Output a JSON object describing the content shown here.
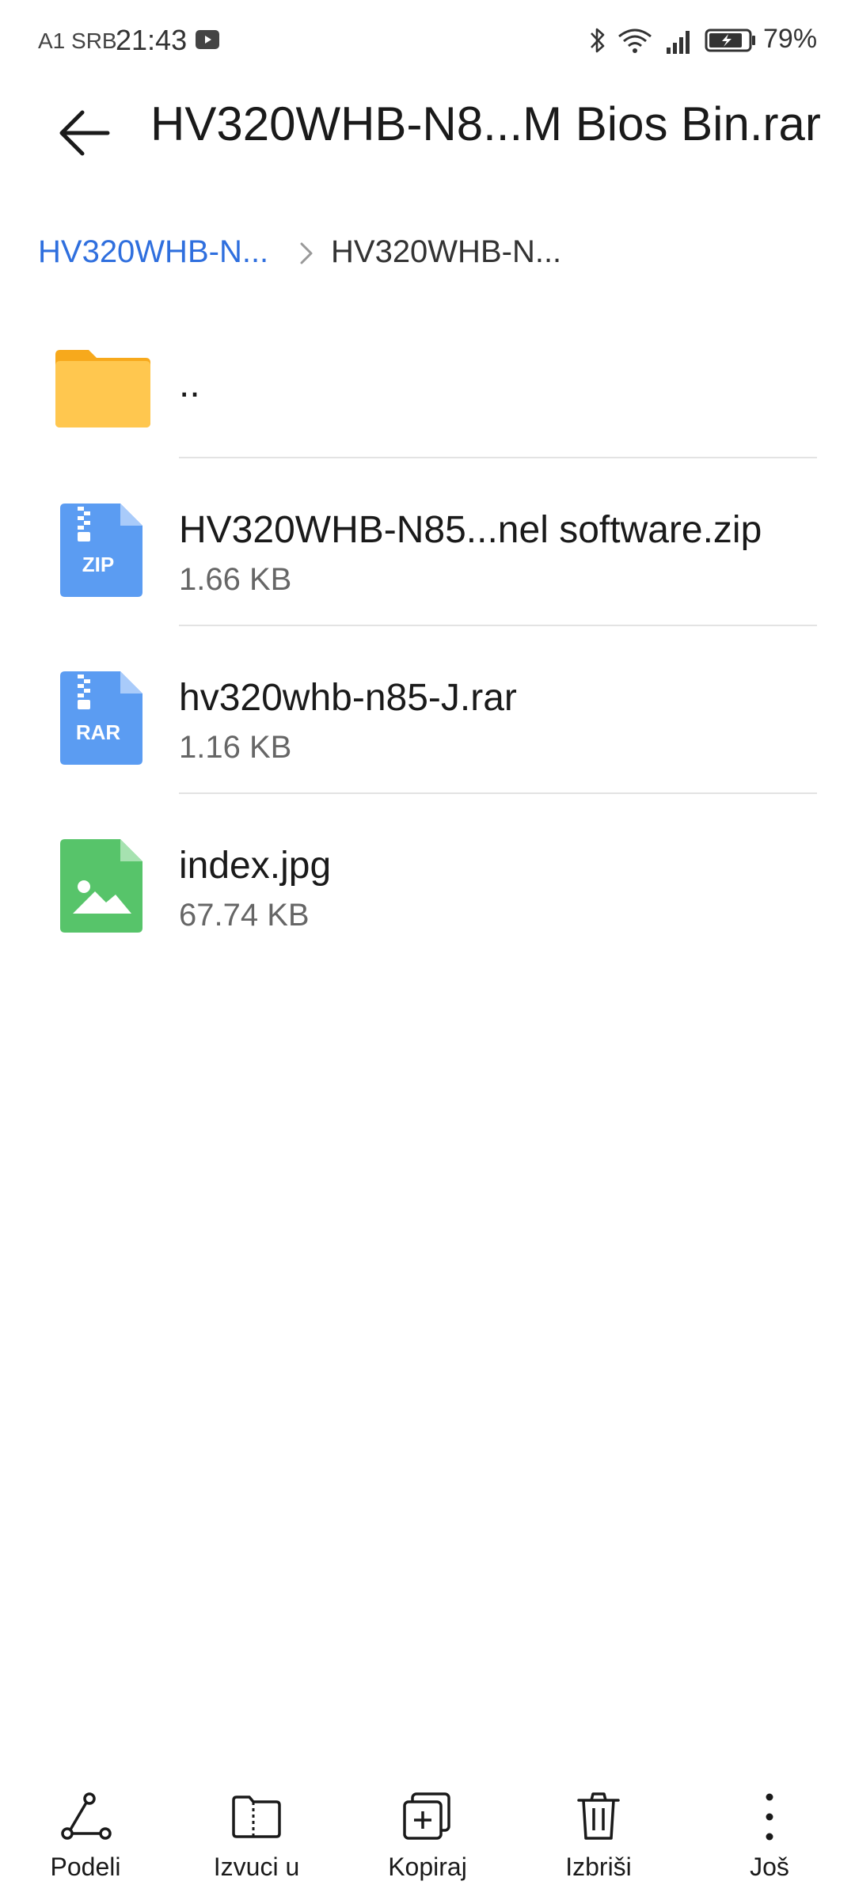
{
  "status_bar": {
    "carrier": "A1 SRB",
    "time": "21:43",
    "battery": "79%",
    "icons": [
      "youtube-icon",
      "bluetooth-icon",
      "wifi-icon",
      "signal-icon",
      "battery-icon"
    ]
  },
  "header": {
    "title": "HV320WHB-N8...M Bios Bin.rar",
    "back_icon": "back-arrow-icon"
  },
  "breadcrumb": {
    "items": [
      "HV320WHB-N...",
      "HV320WHB-N..."
    ]
  },
  "files": [
    {
      "name": "..",
      "size": "",
      "icon": "folder-icon"
    },
    {
      "name": "HV320WHB-N85...nel software.zip",
      "size": "1.66 KB",
      "icon": "zip-file-icon",
      "badge": "ZIP"
    },
    {
      "name": "hv320whb-n85-J.rar",
      "size": "1.16 KB",
      "icon": "rar-file-icon",
      "badge": "RAR"
    },
    {
      "name": "index.jpg",
      "size": "67.74 KB",
      "icon": "image-file-icon"
    }
  ],
  "toolbar": {
    "items": [
      {
        "label": "Podeli",
        "icon": "share-icon"
      },
      {
        "label": "Izvuci u",
        "icon": "extract-folder-icon"
      },
      {
        "label": "Kopiraj",
        "icon": "copy-icon"
      },
      {
        "label": "Izbriši",
        "icon": "trash-icon"
      },
      {
        "label": "Još",
        "icon": "more-icon"
      }
    ]
  },
  "colors": {
    "accent": "#2f6fde",
    "folder": "#ffc24c",
    "archive": "#5b9cf2",
    "image": "#57c46a"
  }
}
